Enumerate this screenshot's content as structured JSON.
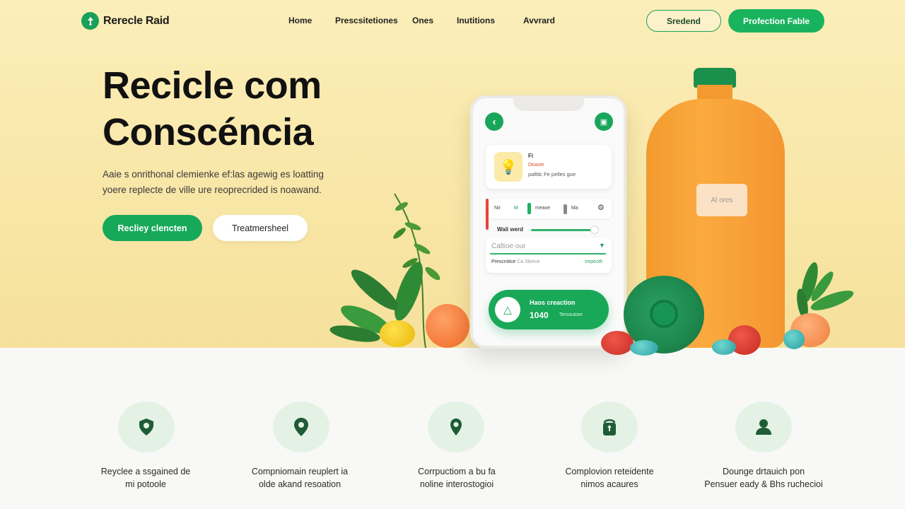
{
  "brand": {
    "name": "Rerecle Raid"
  },
  "nav": {
    "items": [
      "Home",
      "Prescsitetiones",
      "Ones",
      "Inutitions",
      "Avvrard"
    ],
    "secondary_button": "Sredend",
    "primary_button": "Profection Fable"
  },
  "hero": {
    "title_line1": "Recicle com",
    "title_line2": "Conscéncia",
    "subtitle_line1": "Aaie s onrithonal clemienke ef:las agewig es loatting",
    "subtitle_line2": "yoere replecte de ville ure reoprecrided is noawand.",
    "primary_cta": "Recliey clencten",
    "secondary_cta": "Treatmersheel"
  },
  "phone": {
    "card_title": "Fi",
    "card_status": "Deaset",
    "card_desc": "palfdc Fe pelles gue",
    "controls": [
      "Nir",
      "M",
      "meaxe",
      "Ma"
    ],
    "slider_label": "Wali werd",
    "input_placeholder": "Caltioe our",
    "input_left": "Prescnitice",
    "input_left2": "Ca Sleeve",
    "input_right": "Irepeoth",
    "pill_title": "Haos creaction",
    "pill_value": "1040",
    "pill_sub": "Tersoutoer"
  },
  "bottle": {
    "label": "Al ores"
  },
  "features": [
    {
      "icon": "shield-pin-icon",
      "line1": "Reyclee a ssgained de",
      "line2": "mi potoole"
    },
    {
      "icon": "location-pin-icon",
      "line1": "Compniomain reuplert ia",
      "line2": "olde akand resoation"
    },
    {
      "icon": "map-pin-icon",
      "line1": "Corrpuctiom a bu fa",
      "line2": "noline interostogioi"
    },
    {
      "icon": "recycle-box-icon",
      "line1": "Complovion reteidente",
      "line2": "nimos acaures"
    },
    {
      "icon": "user-icon",
      "line1": "Dounge drtauich pon",
      "line2": "Pensuer eady & Bhs ruchecioi"
    }
  ],
  "colors": {
    "accent": "#17a85a",
    "hero_bg": "#f8e6a6",
    "bottle": "#f39a2d"
  }
}
